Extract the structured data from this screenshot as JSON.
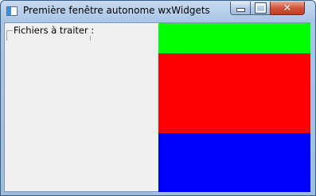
{
  "window": {
    "title": "Première fenêtre autonome wxWidgets",
    "icon": "wx-app-icon",
    "controls": {
      "minimize": "minimize-icon",
      "maximize": "maximize-icon",
      "close": "close-icon",
      "close_glyph": "✕"
    }
  },
  "client": {
    "group_label": "Fichiers à traiter :",
    "panels": [
      {
        "name": "green-panel",
        "color": "#00ff00"
      },
      {
        "name": "red-panel",
        "color": "#ff0000"
      },
      {
        "name": "blue-panel",
        "color": "#0000ff"
      }
    ]
  }
}
